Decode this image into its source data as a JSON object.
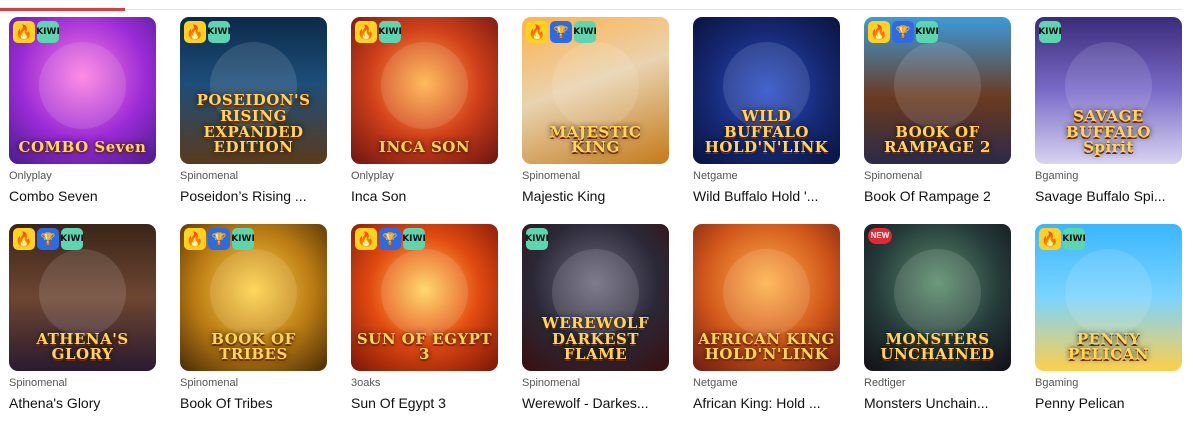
{
  "badges": {
    "hot": "🔥",
    "cup": "🏆",
    "kiwi": "KIWI",
    "new": "NEW"
  },
  "games": [
    {
      "provider": "Onlyplay",
      "name": "Combo Seven",
      "art": "COMBO Seven",
      "badges": [
        "hot",
        "kiwi"
      ],
      "bg": "radial-gradient(circle at 50% 40%, #ff7de0 0%, #9b2bd6 55%, #4a1b8c 100%)"
    },
    {
      "provider": "Spinomenal",
      "name": "Poseidon’s Rising ...",
      "art": "POSEIDON'S RISING EXPANDED EDITION",
      "badges": [
        "hot",
        "kiwi"
      ],
      "bg": "linear-gradient(180deg,#0c2a4a 0%,#1c4e7a 45%,#5a3a1a 100%)"
    },
    {
      "provider": "Onlyplay",
      "name": "Inca Son",
      "art": "INCA SON",
      "badges": [
        "hot",
        "kiwi"
      ],
      "bg": "radial-gradient(circle at 50% 45%, #ffb347 0%, #d1401a 50%, #6b1410 100%)"
    },
    {
      "provider": "Spinomenal",
      "name": "Majestic King",
      "art": "MAJESTIC KING",
      "badges": [
        "hot",
        "cup",
        "kiwi"
      ],
      "bg": "linear-gradient(160deg,#ffb14a 0%,#e9d3b0 45%,#c47a1a 100%)"
    },
    {
      "provider": "Netgame",
      "name": "Wild Buffalo Hold '...",
      "art": "WILD BUFFALO HOLD'N'LINK",
      "badges": [],
      "bg": "radial-gradient(circle at 50% 50%, #2a4fc8 0%, #14266e 60%, #0a1440 100%)"
    },
    {
      "provider": "Spinomenal",
      "name": "Book Of Rampage 2",
      "art": "BOOK OF RAMPAGE 2",
      "badges": [
        "hot",
        "cup",
        "kiwi"
      ],
      "bg": "linear-gradient(180deg,#3b9ad9 0%,#6b3a1e 55%,#2a2a4a 100%)"
    },
    {
      "provider": "Bgaming",
      "name": "Savage Buffalo Spi...",
      "art": "SAVAGE BUFFALO Spirit",
      "badges": [
        "kiwi"
      ],
      "bg": "linear-gradient(180deg,#3a2c7a 0%,#7a6ac8 50%,#d8d4f0 100%)"
    },
    {
      "provider": "Spinomenal",
      "name": "Athena's Glory",
      "art": "ATHENA'S GLORY",
      "badges": [
        "hot",
        "cup",
        "kiwi"
      ],
      "bg": "linear-gradient(180deg,#3a2518 0%,#6e4632 50%,#2a1a30 100%)"
    },
    {
      "provider": "Spinomenal",
      "name": "Book Of Tribes",
      "art": "BOOK OF TRIBES",
      "badges": [
        "hot",
        "cup",
        "kiwi"
      ],
      "bg": "radial-gradient(circle at 50% 45%, #ffd24a 0%, #b87a12 55%, #4a2a06 100%)"
    },
    {
      "provider": "3oaks",
      "name": "Sun Of Egypt 3",
      "art": "SUN OF EGYPT 3",
      "badges": [
        "hot",
        "cup",
        "kiwi"
      ],
      "bg": "radial-gradient(circle at 50% 45%, #ffd45a 0%, #e24a10 50%, #7a1408 100%)"
    },
    {
      "provider": "Spinomenal",
      "name": "Werewolf - Darkes...",
      "art": "WEREWOLF DARKEST FLAME",
      "badges": [
        "kiwi"
      ],
      "bg": "radial-gradient(circle at 50% 40%, #6e6a80 0%, #2a2836 55%, #3a0e0e 100%)"
    },
    {
      "provider": "Netgame",
      "name": "African King: Hold ...",
      "art": "AFRICAN KING HOLD'N'LINK",
      "badges": [],
      "bg": "radial-gradient(circle at 50% 40%, #ffb24a 0%, #d0561a 55%, #6a1a10 100%)"
    },
    {
      "provider": "Redtiger",
      "name": "Monsters Unchain...",
      "art": "MONSTERS UNCHAINED",
      "badges": [
        "new"
      ],
      "bg": "radial-gradient(circle at 50% 40%, #5a8c6a 0%, #253a3a 55%, #120e14 100%)"
    },
    {
      "provider": "Bgaming",
      "name": "Penny Pelican",
      "art": "PENNY PELICAN",
      "badges": [
        "hot",
        "kiwi"
      ],
      "bg": "linear-gradient(180deg,#3ab6ff 0%,#7ad4ff 50%,#ffcf4a 100%)"
    }
  ]
}
